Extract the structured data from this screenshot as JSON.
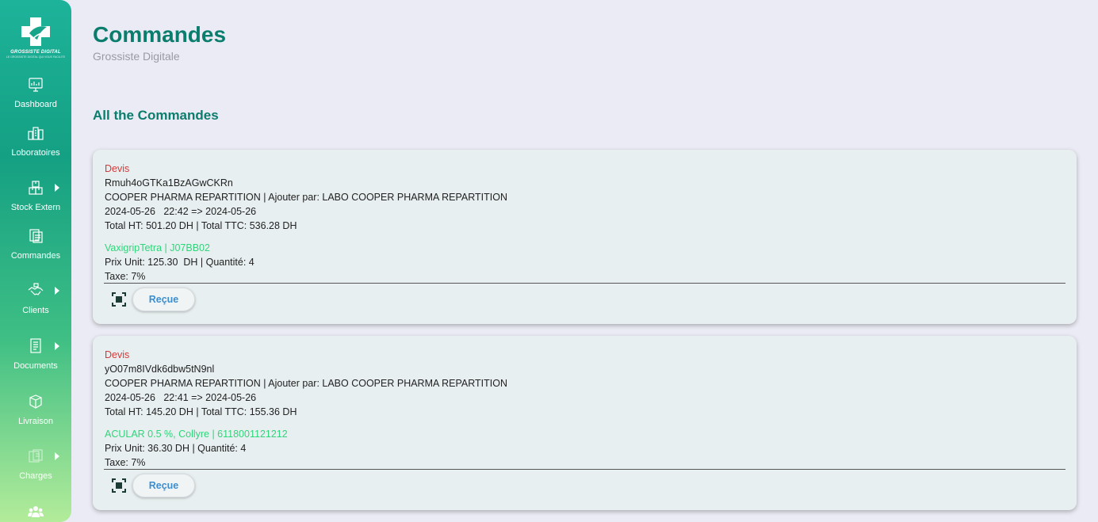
{
  "brand": {
    "name": "GROSSISTE DIGITAL",
    "tagline": "LE GROSSISTE DIGITAL QUI VOUS FACILITE"
  },
  "sidebar": {
    "items": [
      {
        "label": "Dashboard",
        "icon": "dashboard-icon"
      },
      {
        "label": "Loboratoires",
        "icon": "laboratory-icon"
      },
      {
        "label": "Stock Extern",
        "icon": "boxes-icon",
        "has_submenu": true
      },
      {
        "label": "Commandes",
        "icon": "orders-icon"
      },
      {
        "label": "Clients",
        "icon": "handshake-icon",
        "has_submenu": true
      },
      {
        "label": "Documents",
        "icon": "document-icon",
        "has_submenu": true
      },
      {
        "label": "Livraison",
        "icon": "delivery-box-icon"
      },
      {
        "label": "Charges",
        "icon": "charges-icon",
        "has_submenu": true
      },
      {
        "label": "",
        "icon": "users-icon"
      }
    ]
  },
  "header": {
    "title": "Commandes",
    "subtitle": "Grossiste Digitale"
  },
  "section": {
    "title": "All the Commandes"
  },
  "orders": [
    {
      "status": "Devis",
      "reference": "Rmuh4oGTKa1BzAGwCKRn",
      "supplier_line": "COOPER PHARMA REPARTITION | Ajouter par: LABO COOPER PHARMA REPARTITION",
      "date_line": "2024-05-26   22:42 => 2024-05-26",
      "totals_line": "Total HT: 501.20 DH | Total TTC: 536.28 DH",
      "product": "VaxigripTetra | J07BB02",
      "price_line": "Prix Unit: 125.30  DH | Quantité: 4",
      "tax_line": "Taxe: 7%",
      "button": "Reçue"
    },
    {
      "status": "Devis",
      "reference": "yO07m8IVdk6dbw5tN9nl",
      "supplier_line": "COOPER PHARMA REPARTITION | Ajouter par: LABO COOPER PHARMA REPARTITION",
      "date_line": "2024-05-26   22:41 => 2024-05-26",
      "totals_line": "Total HT: 145.20 DH | Total TTC: 155.36 DH",
      "product": "ACULAR 0.5 %, Collyre | 6118001121212",
      "price_line": "Prix Unit: 36.30 DH | Quantité: 4",
      "tax_line": "Taxe: 7%",
      "button": "Reçue"
    }
  ],
  "colors": {
    "accent": "#0a7d6d",
    "status_devis": "#d13a3a",
    "product": "#2fd57a",
    "button_text": "#3b8ecf"
  }
}
